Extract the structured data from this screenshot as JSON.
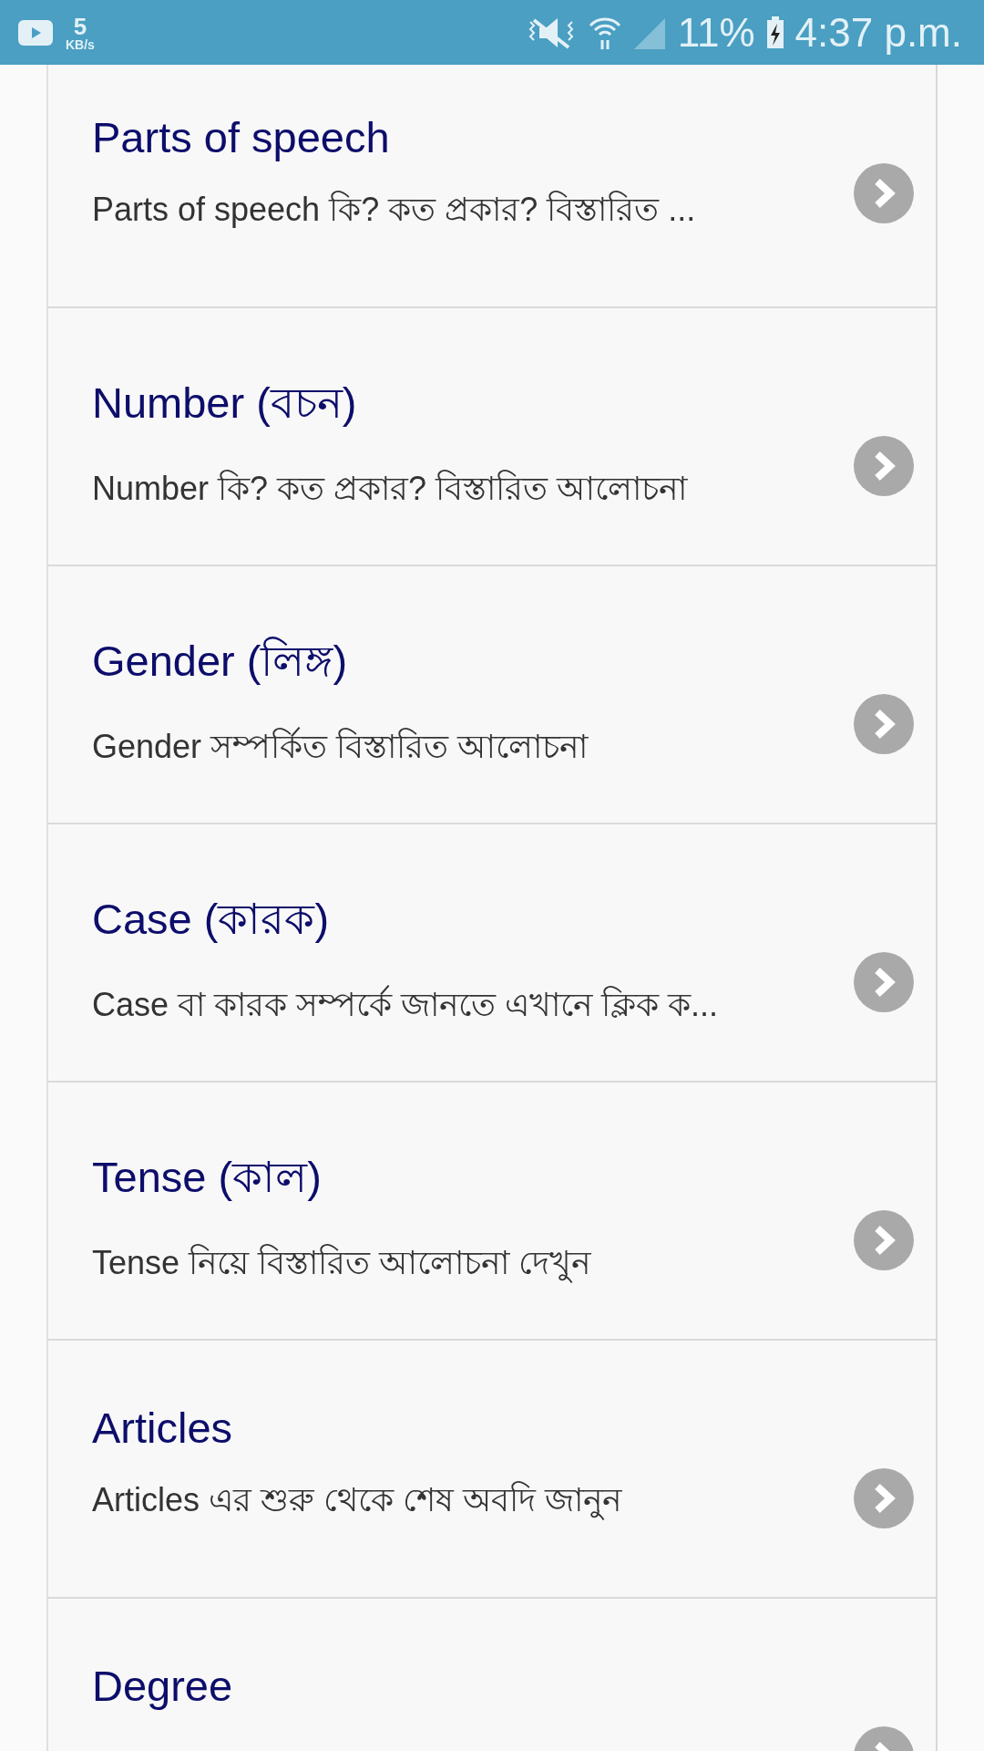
{
  "status_bar": {
    "speed_value": "5",
    "speed_unit": "KB/s",
    "battery": "11%",
    "time": "4:37 p.m."
  },
  "topics": [
    {
      "title": "Parts of speech",
      "subtitle": "Parts of speech কি? কত প্রকার? বিস্তারিত ..."
    },
    {
      "title": "Number (বচন)",
      "subtitle": "Number কি? কত প্রকার? বিস্তারিত আলোচনা"
    },
    {
      "title": "Gender (লিঙ্গ)",
      "subtitle": "Gender সম্পর্কিত বিস্তারিত আলোচনা"
    },
    {
      "title": "Case (কারক)",
      "subtitle": "Case বা কারক সম্পর্কে জানতে এখানে ক্লিক ক..."
    },
    {
      "title": "Tense (কাল)",
      "subtitle": "Tense নিয়ে বিস্তারিত আলোচনা দেখুন"
    },
    {
      "title": "Articles",
      "subtitle": "Articles এর শুরু থেকে শেষ অবদি জানুন"
    },
    {
      "title": "Degree"
    }
  ]
}
